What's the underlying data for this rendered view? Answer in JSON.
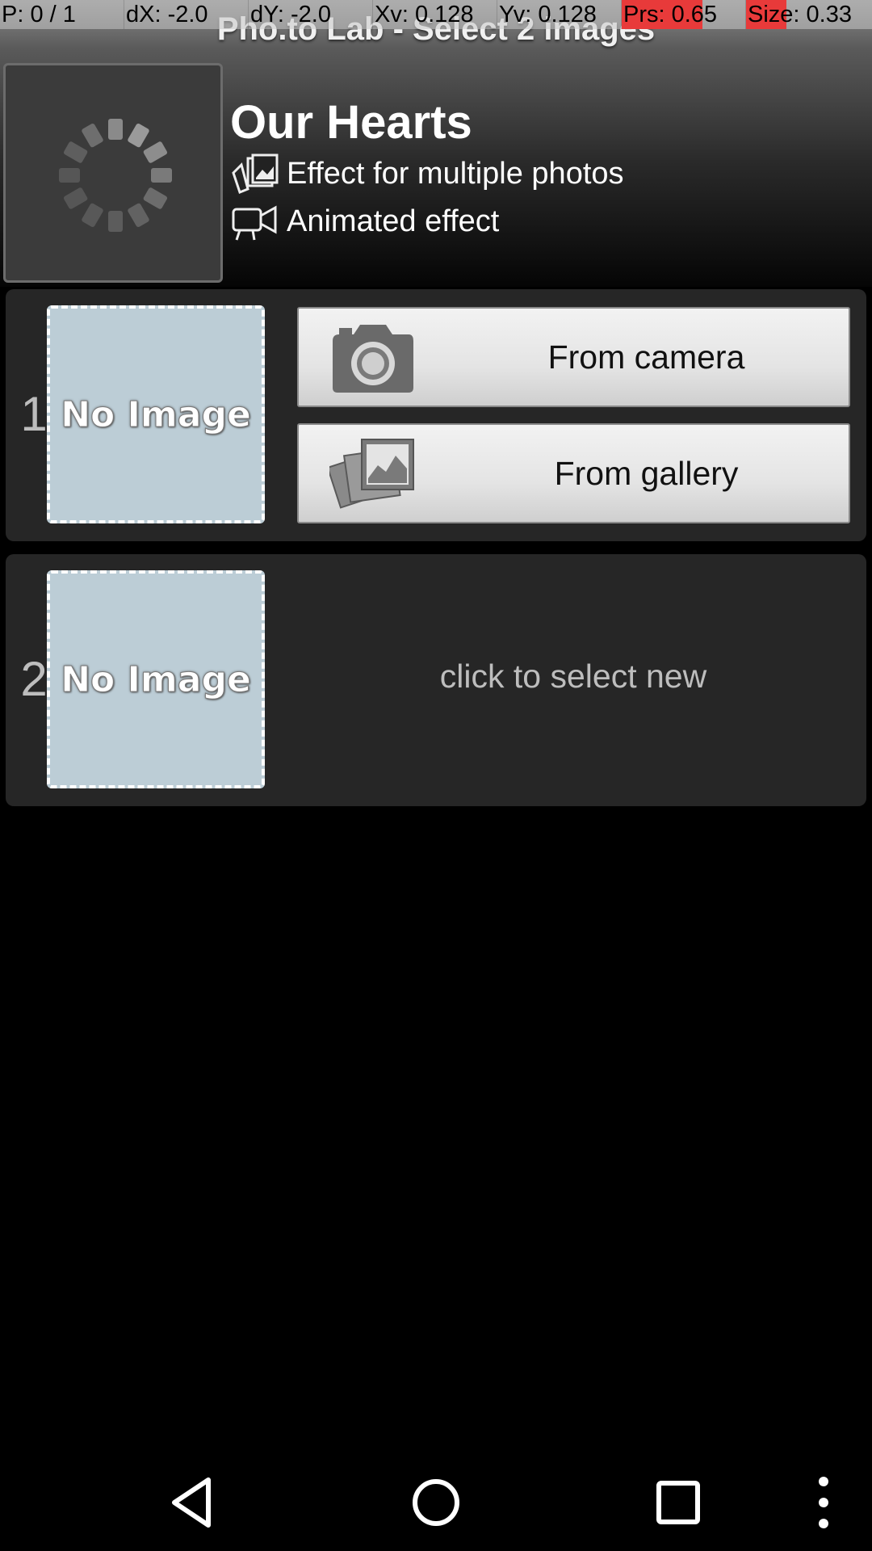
{
  "debug": {
    "p": "P: 0 / 1",
    "dx": "dX: -2.0",
    "dy": "dY: -2.0",
    "xv": "Xv: 0.128",
    "yv": "Yv: 0.128",
    "prs": "Prs: 0.65",
    "size": "Size: 0.33",
    "highlight_color": "#e83a3a"
  },
  "header": {
    "app_title": "Pho.to Lab - Select 2 images",
    "effect_title": "Our Hearts",
    "features": [
      {
        "icon": "multi-photo-icon",
        "label": "Effect for multiple photos"
      },
      {
        "icon": "video-camera-icon",
        "label": "Animated effect"
      }
    ]
  },
  "slots": [
    {
      "number": "1",
      "placeholder": "No Image",
      "buttons": [
        {
          "icon": "camera-icon",
          "label": "From camera"
        },
        {
          "icon": "gallery-icon",
          "label": "From gallery"
        }
      ]
    },
    {
      "number": "2",
      "placeholder": "No Image",
      "hint": "click to select new"
    }
  ],
  "navbar": {
    "back": "back-icon",
    "home": "home-icon",
    "recents": "recents-icon",
    "menu": "overflow-menu-icon"
  }
}
